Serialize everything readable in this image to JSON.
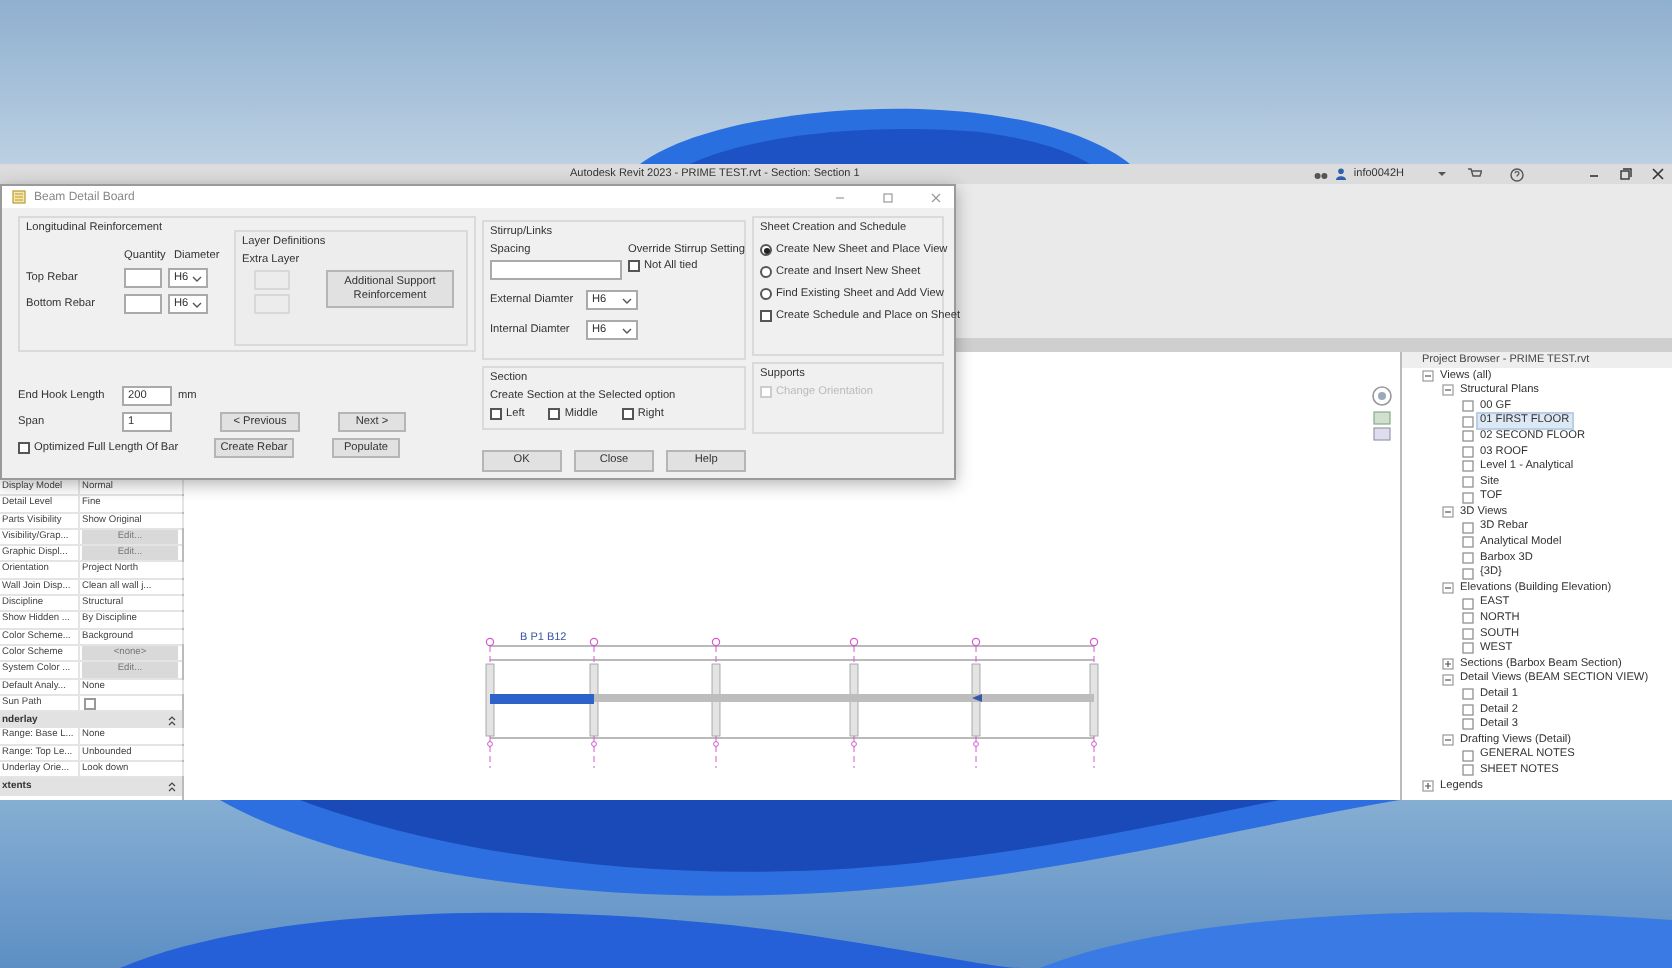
{
  "revit_window": {
    "title": "Autodesk Revit 2023 - PRIME TEST.rvt - Section: Section 1",
    "user": "info0042H"
  },
  "dialog": {
    "title": "Beam Detail Board",
    "longitudinal": {
      "title": "Longitudinal Reinforcement",
      "quantity_header": "Quantity",
      "diameter_header": "Diameter",
      "rows": [
        {
          "label": "Top Rebar",
          "diameter": "H6"
        },
        {
          "label": "Bottom Rebar",
          "diameter": "H6"
        }
      ]
    },
    "layer_definitions": {
      "title": "Layer Definitions",
      "label": "Extra Layer",
      "button": "Additional Support Reinforcement"
    },
    "end_hook": {
      "label": "End Hook Length",
      "value": "200",
      "unit": "mm"
    },
    "span": {
      "label": "Span",
      "value": "1"
    },
    "optimized": {
      "label": "Optimized Full Length Of Bar",
      "checked": false
    },
    "nav_buttons": [
      "< Previous",
      "Next >"
    ],
    "action_buttons": [
      "Create Rebar",
      "Populate"
    ],
    "stirrup": {
      "title": "Stirrup/Links",
      "spacing_label": "Spacing",
      "override_title": "Override Stirrup Setting",
      "not_all_tied": {
        "label": "Not All tied",
        "checked": false
      },
      "external": {
        "label": "External Diamter",
        "value": "H6"
      },
      "internal": {
        "label": "Internal Diamter",
        "value": "H6"
      }
    },
    "section": {
      "title": "Section",
      "prompt": "Create Section at the Selected  option",
      "options": [
        {
          "label": "Left",
          "checked": false
        },
        {
          "label": "Middle",
          "checked": false
        },
        {
          "label": "Right",
          "checked": false
        }
      ]
    },
    "footer_buttons": [
      "OK",
      "Close",
      "Help"
    ],
    "sheet": {
      "title": "Sheet Creation and Schedule",
      "options": [
        {
          "label": "Create New Sheet and Place View",
          "selected": true
        },
        {
          "label": "Create  and Insert New Sheet",
          "selected": false
        },
        {
          "label": "Find Existing Sheet and Add View",
          "selected": false
        }
      ],
      "schedule": {
        "label": "Create Schedule and Place on Sheet",
        "checked": false
      }
    },
    "supports": {
      "title": "Supports",
      "change_orientation": {
        "label": "Change Orientation",
        "checked": false,
        "disabled": true
      }
    }
  },
  "properties": {
    "rows": [
      {
        "kind": "value",
        "name": "Display Model",
        "value": "Normal"
      },
      {
        "kind": "value",
        "name": "Detail Level",
        "value": "Fine"
      },
      {
        "kind": "value",
        "name": "Parts Visibility",
        "value": "Show Original"
      },
      {
        "kind": "button",
        "name": "Visibility/Grap...",
        "value": "Edit..."
      },
      {
        "kind": "button",
        "name": "Graphic Displ...",
        "value": "Edit..."
      },
      {
        "kind": "value",
        "name": "Orientation",
        "value": "Project North"
      },
      {
        "kind": "value",
        "name": "Wall Join Disp...",
        "value": "Clean all wall j..."
      },
      {
        "kind": "value",
        "name": "Discipline",
        "value": "Structural"
      },
      {
        "kind": "value",
        "name": "Show Hidden ...",
        "value": "By Discipline"
      },
      {
        "kind": "value",
        "name": "Color Scheme...",
        "value": "Background"
      },
      {
        "kind": "button",
        "name": "Color Scheme",
        "value": "<none>"
      },
      {
        "kind": "button",
        "name": "System Color ...",
        "value": "Edit..."
      },
      {
        "kind": "value",
        "name": "Default Analy...",
        "value": "None"
      },
      {
        "kind": "check",
        "name": "Sun Path",
        "checked": false
      },
      {
        "kind": "group",
        "name": "nderlay"
      },
      {
        "kind": "value",
        "name": "Range: Base L...",
        "value": "None"
      },
      {
        "kind": "value",
        "name": "Range: Top Le...",
        "value": "Unbounded"
      },
      {
        "kind": "value",
        "name": "Underlay Orie...",
        "value": "Look down"
      },
      {
        "kind": "group",
        "name": "xtents"
      }
    ]
  },
  "canvas": {
    "beam_label": "B P1 B12"
  },
  "project_browser": {
    "title": "Project Browser - PRIME TEST.rvt",
    "tree": [
      {
        "label": "Views (all)",
        "expanded": true,
        "children": [
          {
            "label": "Structural Plans",
            "expanded": true,
            "children": [
              {
                "label": "00 GF",
                "selected": false
              },
              {
                "label": "01 FIRST FLOOR",
                "selected": true
              },
              {
                "label": "02 SECOND FLOOR",
                "selected": false
              },
              {
                "label": "03 ROOF",
                "selected": false
              },
              {
                "label": "Level 1 - Analytical",
                "selected": false
              },
              {
                "label": "Site",
                "selected": false
              },
              {
                "label": "TOF",
                "selected": false
              }
            ]
          },
          {
            "label": "3D Views",
            "expanded": true,
            "children": [
              {
                "label": "3D Rebar",
                "selected": false
              },
              {
                "label": "Analytical Model",
                "selected": false
              },
              {
                "label": "Barbox 3D",
                "selected": false
              },
              {
                "label": "{3D}",
                "selected": false
              }
            ]
          },
          {
            "label": "Elevations (Building Elevation)",
            "expanded": true,
            "children": [
              {
                "label": "EAST",
                "selected": false
              },
              {
                "label": "NORTH",
                "selected": false
              },
              {
                "label": "SOUTH",
                "selected": false
              },
              {
                "label": "WEST",
                "selected": false
              }
            ]
          },
          {
            "label": "Sections (Barbox Beam Section)",
            "expanded": false
          },
          {
            "label": "Detail Views (BEAM SECTION VIEW)",
            "expanded": true,
            "children": [
              {
                "label": "Detail 1",
                "selected": false
              },
              {
                "label": "Detail 2",
                "selected": false
              },
              {
                "label": "Detail 3",
                "selected": false
              }
            ]
          },
          {
            "label": "Drafting Views (Detail)",
            "expanded": true,
            "children": [
              {
                "label": "GENERAL NOTES",
                "selected": false
              },
              {
                "label": "SHEET NOTES",
                "selected": false
              }
            ]
          }
        ]
      },
      {
        "label": "Legends",
        "expanded": false
      }
    ]
  }
}
